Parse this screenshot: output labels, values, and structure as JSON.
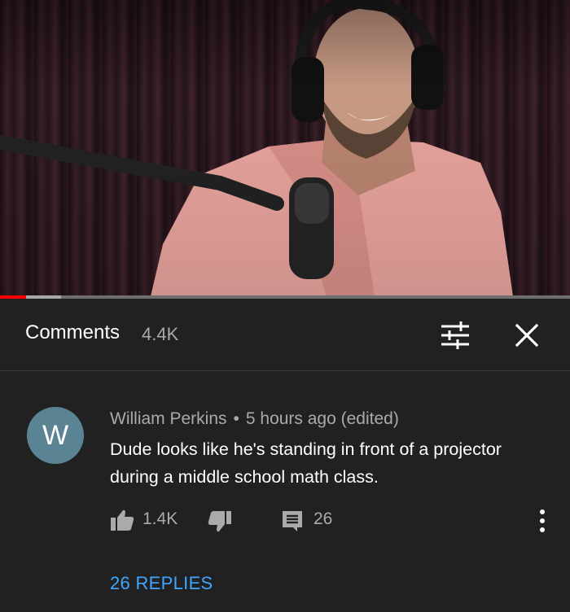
{
  "video": {
    "progress_fraction": 0.045,
    "buffered_fraction": 0.107
  },
  "comments_panel": {
    "title": "Comments",
    "count": "4.4K",
    "filter_icon": "sort-filter-icon",
    "close_icon": "close-icon"
  },
  "comment": {
    "avatar_letter": "W",
    "avatar_color": "#5a8494",
    "author": "William Perkins",
    "separator": "•",
    "time": "5 hours ago (edited)",
    "text": "Dude looks like he's standing in front of a projector during a middle school math class.",
    "like_count": "1.4K",
    "reply_count": "26",
    "replies_label": "26 REPLIES",
    "link_color": "#3ea6ff"
  }
}
